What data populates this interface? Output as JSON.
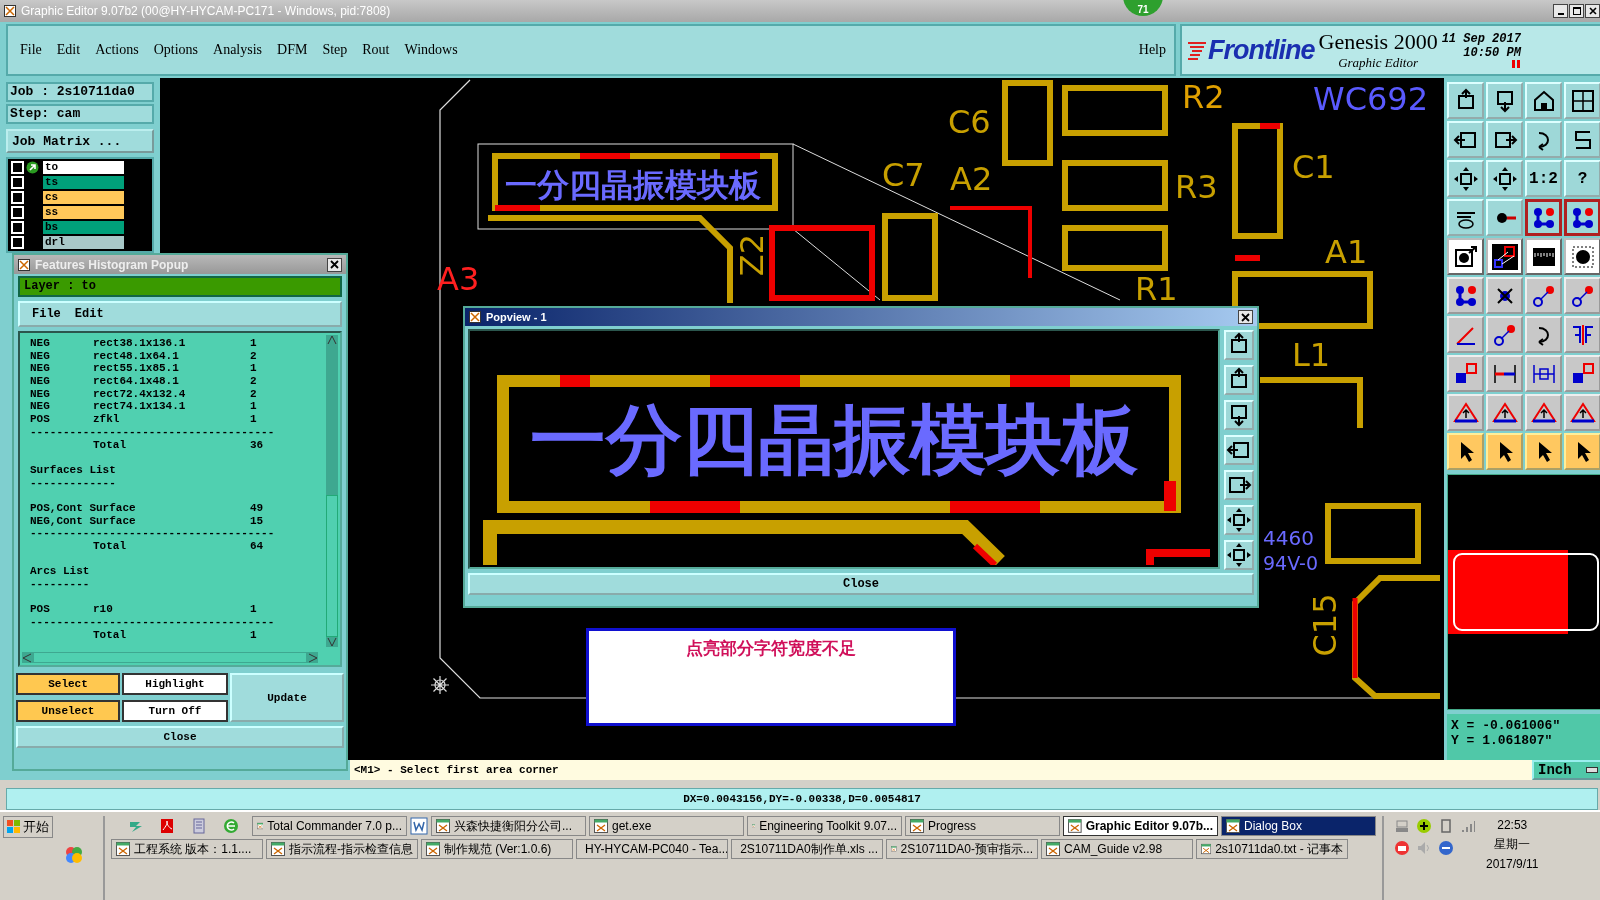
{
  "window": {
    "title": "Graphic Editor 9.07b2 (00@HY-HYCAM-PC171 - Windows, pid:7808)",
    "badge": "71"
  },
  "menu": [
    "File",
    "Edit",
    "Actions",
    "Options",
    "Analysis",
    "DFM",
    "Step",
    "Rout",
    "Windows"
  ],
  "help": "Help",
  "brand": {
    "logo": "Frontline",
    "product": "Genesis 2000",
    "subtitle": "Graphic Editor",
    "date": "11 Sep 2017",
    "time": "10:50 PM"
  },
  "job": {
    "job": "Job : 2s10711da0",
    "step": "Step: cam",
    "matrix_button": "Job Matrix ..."
  },
  "layers": [
    {
      "name": "to",
      "color": "#ffffff",
      "active": true,
      "checked": false
    },
    {
      "name": "ts",
      "color": "#00a07a",
      "active": false,
      "checked": false
    },
    {
      "name": "cs",
      "color": "#ffc85a",
      "active": false,
      "checked": false
    },
    {
      "name": "ss",
      "color": "#ffc85a",
      "active": false,
      "checked": false
    },
    {
      "name": "bs",
      "color": "#00a07a",
      "active": false,
      "checked": false
    },
    {
      "name": "drl",
      "color": "#a8c8c8",
      "active": false,
      "checked": false
    }
  ],
  "canvas": {
    "labels": [
      "R2",
      "WC692",
      "C6",
      "C7",
      "A2",
      "R3",
      "C1",
      "Z2",
      "A1",
      "R1",
      "L1",
      "A3",
      "4460",
      "94V-0",
      "C15"
    ],
    "board_text": "一分四晶振模块板"
  },
  "toolbar": [
    {
      "kind": "box-up"
    },
    {
      "kind": "box-down"
    },
    {
      "kind": "house"
    },
    {
      "kind": "grid"
    },
    {
      "kind": "box-left"
    },
    {
      "kind": "box-right"
    },
    {
      "kind": "curve"
    },
    {
      "kind": "zigzag"
    },
    {
      "kind": "expand"
    },
    {
      "kind": "expand"
    },
    {
      "kind": "text",
      "label": "1:2"
    },
    {
      "kind": "text",
      "label": "?"
    },
    {
      "kind": "tools"
    },
    {
      "kind": "pin"
    },
    {
      "kind": "nodes",
      "framed": true
    },
    {
      "kind": "nodes",
      "framed": true
    },
    {
      "kind": "target"
    },
    {
      "kind": "square-line"
    },
    {
      "kind": "ruler"
    },
    {
      "kind": "dot"
    },
    {
      "kind": "nodes"
    },
    {
      "kind": "cross"
    },
    {
      "kind": "line"
    },
    {
      "kind": "line"
    },
    {
      "kind": "angle"
    },
    {
      "kind": "line"
    },
    {
      "kind": "curve"
    },
    {
      "kind": "mirror"
    },
    {
      "kind": "squares"
    },
    {
      "kind": "bar"
    },
    {
      "kind": "bracket"
    },
    {
      "kind": "squares"
    },
    {
      "kind": "triangle"
    },
    {
      "kind": "triangle"
    },
    {
      "kind": "triangle"
    },
    {
      "kind": "triangle"
    },
    {
      "kind": "cursor"
    },
    {
      "kind": "cursor"
    },
    {
      "kind": "cursor"
    },
    {
      "kind": "cursor"
    }
  ],
  "coordinates": [
    "X = -0.061006\"",
    "Y = 1.061807\""
  ],
  "histogram": {
    "title": "Features Histogram Popup",
    "layer": "Layer :  to",
    "menu": [
      "File",
      "Edit"
    ],
    "lines": [
      {
        "kind": "row",
        "cols": [
          "NEG",
          "rect38.1x136.1",
          "1"
        ]
      },
      {
        "kind": "row",
        "cols": [
          "NEG",
          "rect48.1x64.1",
          "2"
        ]
      },
      {
        "kind": "row",
        "cols": [
          "NEG",
          "rect55.1x85.1",
          "1"
        ]
      },
      {
        "kind": "row",
        "cols": [
          "NEG",
          "rect64.1x48.1",
          "2"
        ]
      },
      {
        "kind": "row",
        "cols": [
          "NEG",
          "rect72.4x132.4",
          "2"
        ]
      },
      {
        "kind": "row",
        "cols": [
          "NEG",
          "rect74.1x134.1",
          "1"
        ]
      },
      {
        "kind": "row",
        "cols": [
          "POS",
          "zfkl",
          "1"
        ]
      },
      {
        "kind": "rule",
        "text": "-------------------------------------"
      },
      {
        "kind": "total",
        "label": "Total",
        "value": "36"
      },
      {
        "kind": "gap"
      },
      {
        "kind": "heading",
        "text": "Surfaces List"
      },
      {
        "kind": "rule",
        "text": "-------------"
      },
      {
        "kind": "gap"
      },
      {
        "kind": "wide",
        "cols": [
          "POS,Cont Surface",
          "49"
        ]
      },
      {
        "kind": "wide",
        "cols": [
          "NEG,Cont Surface",
          "15"
        ]
      },
      {
        "kind": "rule",
        "text": "-------------------------------------"
      },
      {
        "kind": "total",
        "label": "Total",
        "value": "64"
      },
      {
        "kind": "gap"
      },
      {
        "kind": "heading",
        "text": "Arcs List"
      },
      {
        "kind": "rule",
        "text": "---------"
      },
      {
        "kind": "gap"
      },
      {
        "kind": "row",
        "cols": [
          "POS",
          "r10",
          "1"
        ]
      },
      {
        "kind": "rule",
        "text": "-------------------------------------"
      },
      {
        "kind": "total",
        "label": "Total",
        "value": "1"
      }
    ],
    "buttons": [
      {
        "label": "Select",
        "kind": "orange"
      },
      {
        "label": "Highlight",
        "kind": "white"
      },
      {
        "label": "Update",
        "kind": "tall"
      },
      {
        "label": "Unselect",
        "kind": "orange"
      },
      {
        "label": "Turn Off",
        "kind": "white"
      }
    ],
    "close": "Close"
  },
  "popview": {
    "title": "Popview - 1",
    "board_text": "一分四晶振模块板",
    "tools": [
      {
        "kind": "box-up"
      },
      {
        "kind": "box-up"
      },
      {
        "kind": "box-down"
      },
      {
        "kind": "box-left"
      },
      {
        "kind": "box-right"
      },
      {
        "kind": "expand"
      },
      {
        "kind": "expand"
      }
    ],
    "close": "Close"
  },
  "note": "点亮部分字符宽度不足",
  "prompt": "<M1> - Select first area corner",
  "units": "Inch",
  "status": "DX=0.0043156,DY=-0.00338,D=0.0054817",
  "taskbar": {
    "start": "开始",
    "upper_buttons": [
      {
        "label": "Total Commander 7.0 p...",
        "selected": false,
        "flashing": false
      },
      {
        "label": "兴森快捷衡阳分公司...",
        "selected": false,
        "flashing": false
      },
      {
        "label": "get.exe",
        "selected": false,
        "flashing": false
      },
      {
        "label": "Engineering Toolkit 9.07...",
        "selected": false,
        "flashing": false
      },
      {
        "label": "Progress",
        "selected": false,
        "flashing": false
      },
      {
        "label": "Graphic Editor 9.07b...",
        "selected": true,
        "flashing": false
      },
      {
        "label": "Dialog Box",
        "selected": false,
        "flashing": true
      }
    ],
    "lower_buttons": [
      {
        "label": "工程系统  版本：1.1....",
        "selected": false,
        "flashing": false
      },
      {
        "label": "指示流程-指示检查信息",
        "selected": false,
        "flashing": false
      },
      {
        "label": "制作规范 (Ver:1.0.6)",
        "selected": false,
        "flashing": false
      },
      {
        "label": "HY-HYCAM-PC040 - Tea...",
        "selected": false,
        "flashing": false
      },
      {
        "label": "2S10711DA0制作单.xls ...",
        "selected": false,
        "flashing": false
      },
      {
        "label": "2S10711DA0-预审指示...",
        "selected": false,
        "flashing": false
      },
      {
        "label": "CAM_Guide v2.98",
        "selected": false,
        "flashing": false
      },
      {
        "label": "2s10711da0.txt - 记事本",
        "selected": false,
        "flashing": false
      }
    ],
    "clock": {
      "time": "22:53",
      "weekday": "星期一",
      "date": "2017/9/11"
    }
  }
}
